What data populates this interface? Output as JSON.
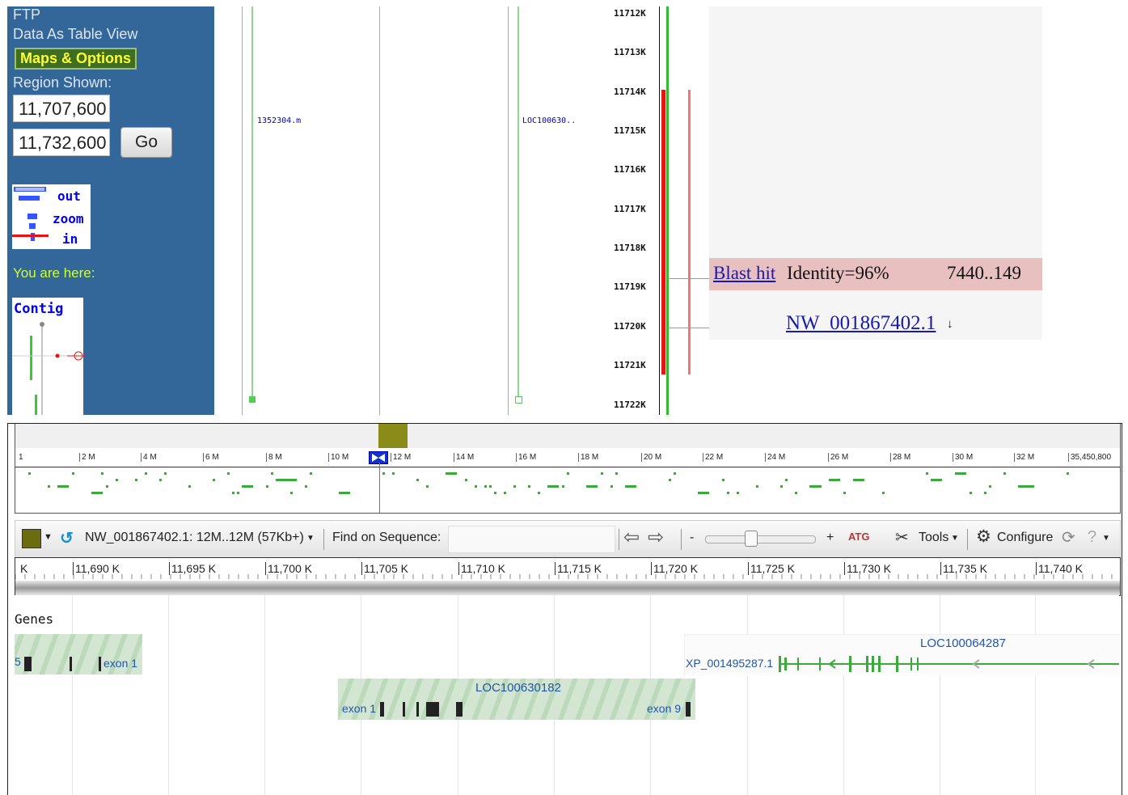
{
  "sidebar": {
    "ftp": "FTP",
    "table_view": "Data As Table View",
    "maps_options": "Maps & Options",
    "region_label": "Region Shown:",
    "region_start": "11,707,600",
    "region_end": "11,732,600",
    "go_label": "Go",
    "zoom_out": "out",
    "zoom_zoom": "zoom",
    "zoom_in": "in",
    "you_are_here": "You are here:",
    "contig_label": "Contig"
  },
  "map": {
    "track1_label": "1352304.m",
    "track2_label": "LOC100630..",
    "ruler_ticks": [
      "11712K",
      "11713K",
      "11714K",
      "11715K",
      "11716K",
      "11717K",
      "11718K",
      "11719K",
      "11720K",
      "11721K",
      "11722K"
    ]
  },
  "blast": {
    "link": "Blast hit",
    "identity": "Identity=96%",
    "range": "7440..149",
    "accession": "NW_001867402.1",
    "arrow": "↓"
  },
  "overview": {
    "ticks": [
      "1",
      "2 M",
      "4 M",
      "6 M",
      "8 M",
      "10 M",
      "12 M",
      "14 M",
      "16 M",
      "18 M",
      "20 M",
      "22 M",
      "24 M",
      "26 M",
      "28 M",
      "30 M",
      "32 M",
      "35,450,800"
    ]
  },
  "toolbar": {
    "sequence": "NW_001867402.1: 12M..12M (57Kb+)",
    "find_label": "Find on Sequence:",
    "find_placeholder": "",
    "zoom_minus": "-",
    "zoom_plus": "+",
    "tools_label": "Tools",
    "configure_label": "Configure",
    "help": "?"
  },
  "ruler2": {
    "ticks": [
      "K",
      "11,690 K",
      "11,695 K",
      "11,700 K",
      "11,705 K",
      "11,710 K",
      "11,715 K",
      "11,720 K",
      "11,725 K",
      "11,730 K",
      "11,735 K",
      "11,740 K"
    ]
  },
  "genes": {
    "title": "Genes",
    "left_exon": "exon 1",
    "left_prefix": "5",
    "gene1_name": "LOC100630182",
    "gene1_exon_first": "exon 1",
    "gene1_exon_last": "exon 9",
    "gene2_name": "LOC100064287",
    "gene2_transcript": "XP_001495287.1"
  },
  "colors": {
    "sidebar_bg": "#336699",
    "gene_green": "#3aaa3a",
    "blast_red": "#ee1111"
  }
}
